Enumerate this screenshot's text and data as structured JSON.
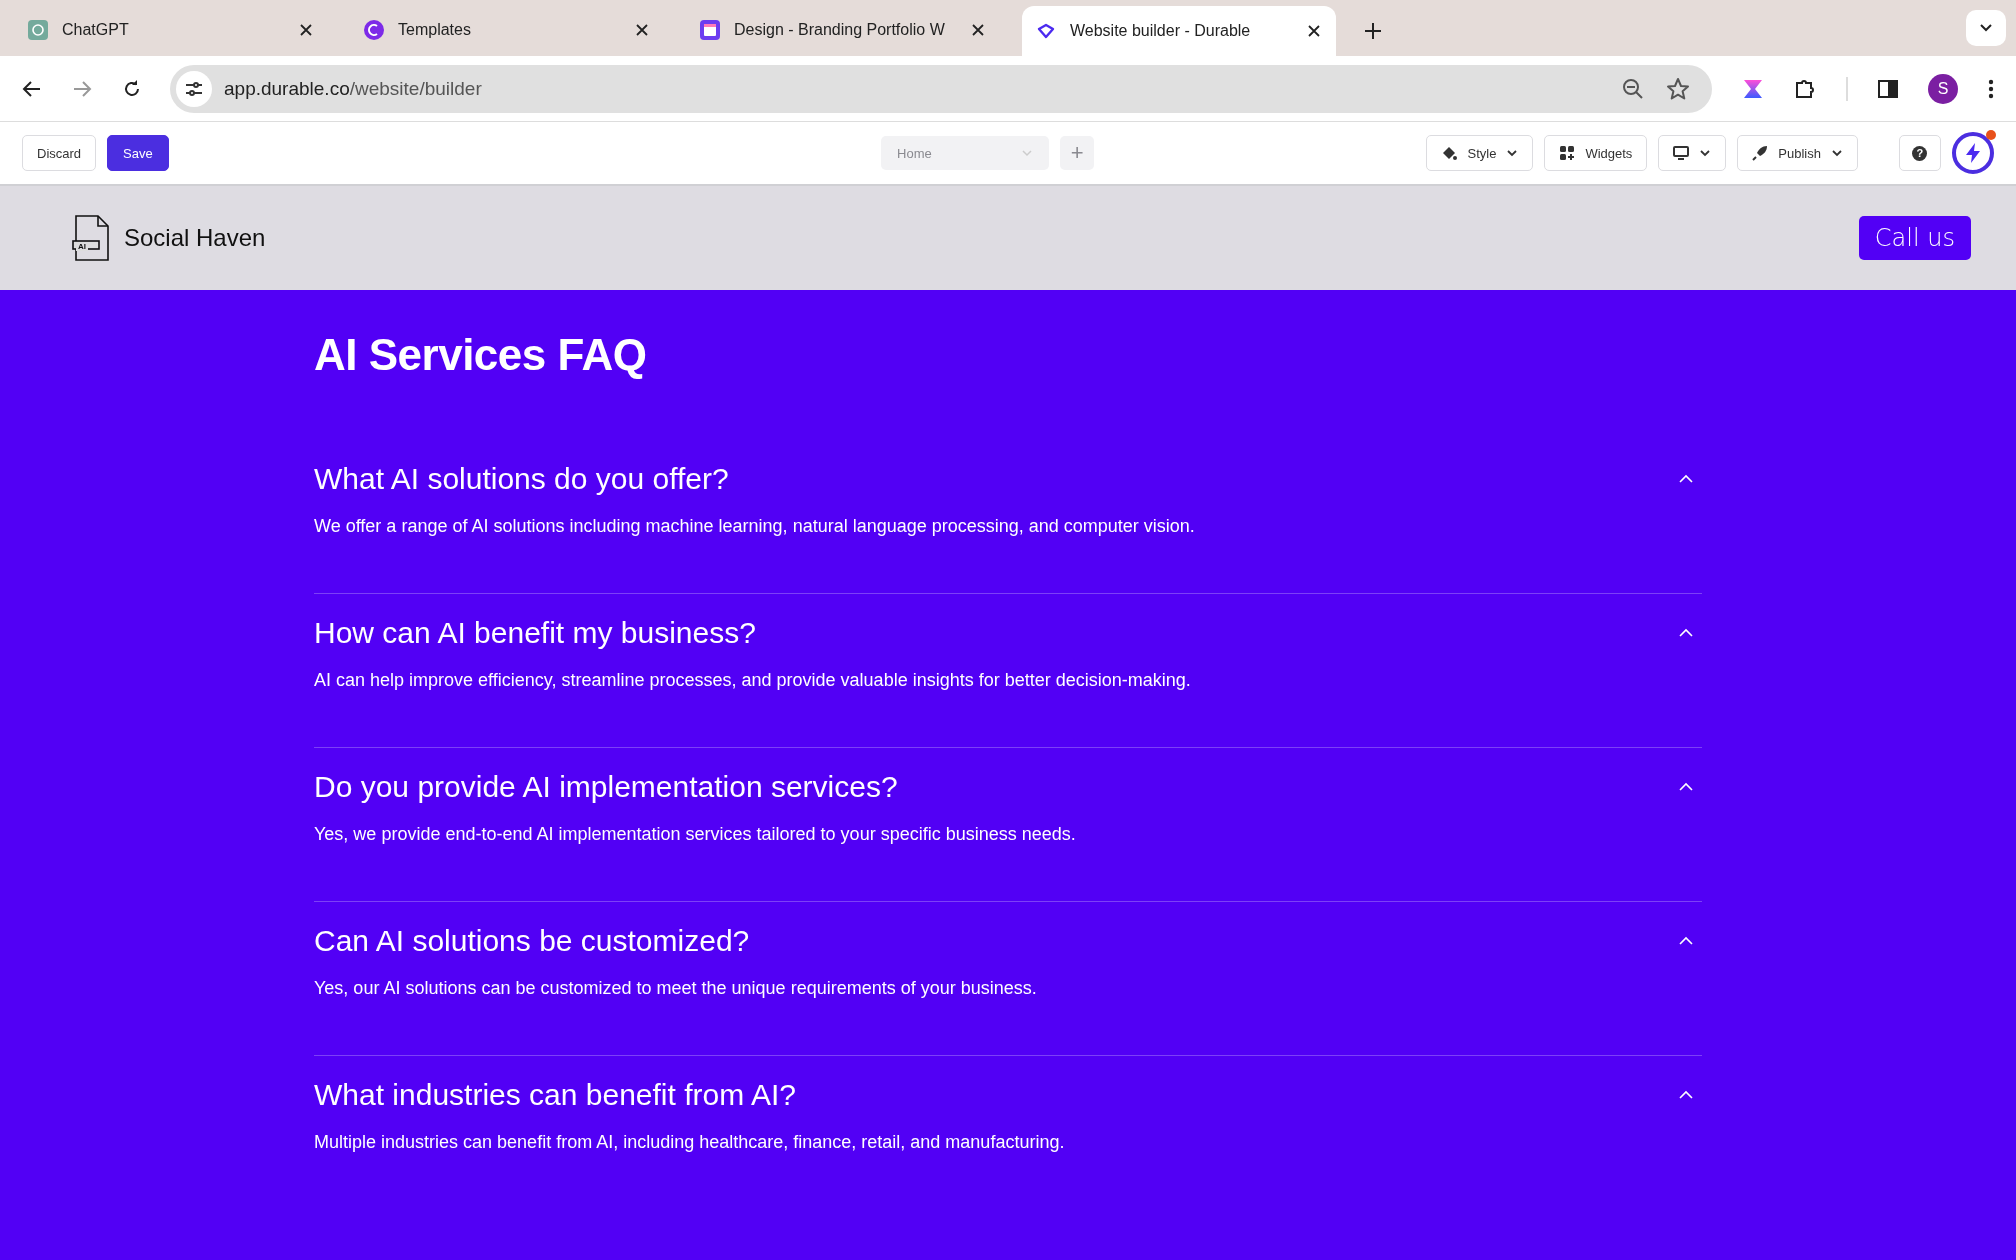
{
  "browser": {
    "tabs": [
      {
        "title": "ChatGPT",
        "selected": false
      },
      {
        "title": "Templates",
        "selected": false
      },
      {
        "title": "Design - Branding Portfolio W",
        "selected": false
      },
      {
        "title": "Website builder - Durable",
        "selected": true
      }
    ],
    "address": {
      "host": "app.durable.co",
      "path": "/website/builder"
    },
    "profile_initial": "S"
  },
  "toolbar": {
    "discard": "Discard",
    "save": "Save",
    "page_select": {
      "value": "Home",
      "disabled": true
    },
    "add_page": "+",
    "style": "Style",
    "widgets": "Widgets",
    "publish": "Publish",
    "help": "?"
  },
  "site_header": {
    "brand": "Social Haven",
    "logo_text": "AI",
    "cta": "Call us"
  },
  "faq": {
    "title": "AI Services FAQ",
    "items": [
      {
        "question": "What AI solutions do you offer?",
        "answer": "We offer a range of AI solutions including machine learning, natural language processing, and computer vision.",
        "expanded": true
      },
      {
        "question": "How can AI benefit my business?",
        "answer": "AI can help improve efficiency, streamline processes, and provide valuable insights for better decision-making.",
        "expanded": true
      },
      {
        "question": "Do you provide AI implementation services?",
        "answer": "Yes, we provide end-to-end AI implementation services tailored to your specific business needs.",
        "expanded": true
      },
      {
        "question": "Can AI solutions be customized?",
        "answer": "Yes, our AI solutions can be customized to meet the unique requirements of your business.",
        "expanded": true
      },
      {
        "question": "What industries can benefit from AI?",
        "answer": "Multiple industries can benefit from AI, including healthcare, finance, retail, and manufacturing.",
        "expanded": true
      }
    ]
  }
}
